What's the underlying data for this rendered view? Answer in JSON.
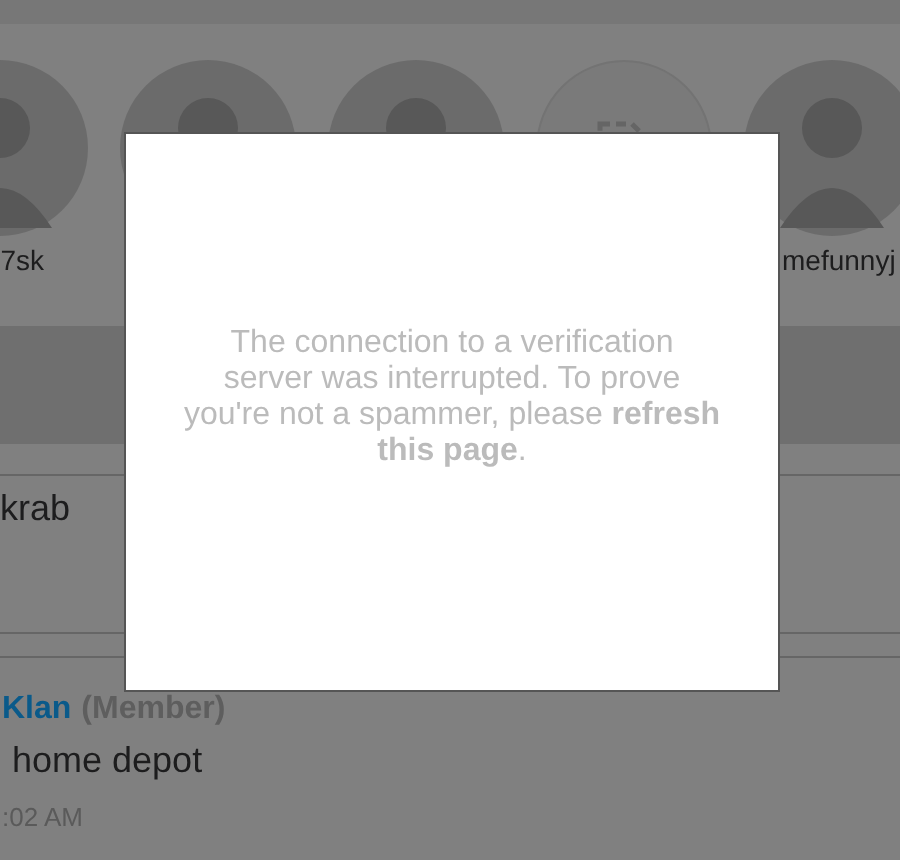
{
  "friends": [
    {
      "kind": "avatar",
      "name": "7sk"
    },
    {
      "kind": "avatar"
    },
    {
      "kind": "avatar"
    },
    {
      "kind": "placeholder"
    },
    {
      "kind": "avatar",
      "name": "mefunnyj"
    }
  ],
  "conversation": {
    "name": "krab"
  },
  "post": {
    "author": "Klan",
    "role": "(Member)",
    "text": "home depot",
    "time": ":02 AM"
  },
  "dialog": {
    "message": "The connection to a verification server was interrupted. To prove you're not a spammer, please **refresh this page**."
  }
}
